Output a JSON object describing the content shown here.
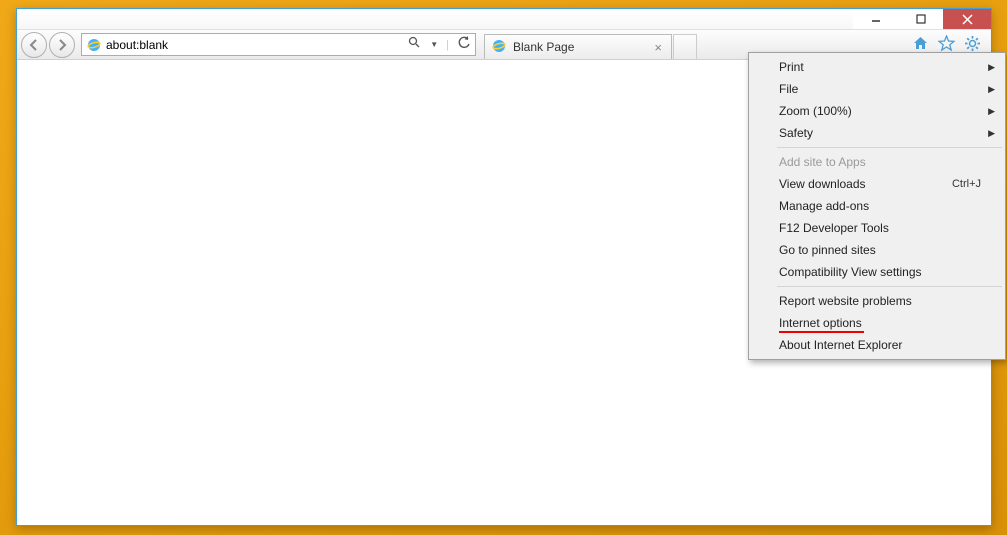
{
  "titlebar": {
    "title_partial": ""
  },
  "window_controls": {
    "min": "—",
    "max": "□",
    "close": "✕"
  },
  "nav": {
    "back": "◄",
    "forward": "►",
    "url": "about:blank",
    "search_dropdown": "▼",
    "refresh": "↻"
  },
  "tab": {
    "label": "Blank Page",
    "close": "×"
  },
  "toolbar_icons": {
    "home": "home-icon",
    "favorites": "star-icon",
    "tools": "gear-icon"
  },
  "menu": {
    "items": [
      {
        "label": "Print",
        "submenu": true
      },
      {
        "label": "File",
        "submenu": true
      },
      {
        "label": "Zoom (100%)",
        "submenu": true
      },
      {
        "label": "Safety",
        "submenu": true
      }
    ],
    "group2": [
      {
        "label": "Add site to Apps",
        "disabled": true
      },
      {
        "label": "View downloads",
        "shortcut": "Ctrl+J"
      },
      {
        "label": "Manage add-ons"
      },
      {
        "label": "F12 Developer Tools"
      },
      {
        "label": "Go to pinned sites"
      },
      {
        "label": "Compatibility View settings"
      }
    ],
    "group3": [
      {
        "label": "Report website problems"
      },
      {
        "label": "Internet options",
        "highlight": true
      },
      {
        "label": "About Internet Explorer"
      }
    ]
  }
}
